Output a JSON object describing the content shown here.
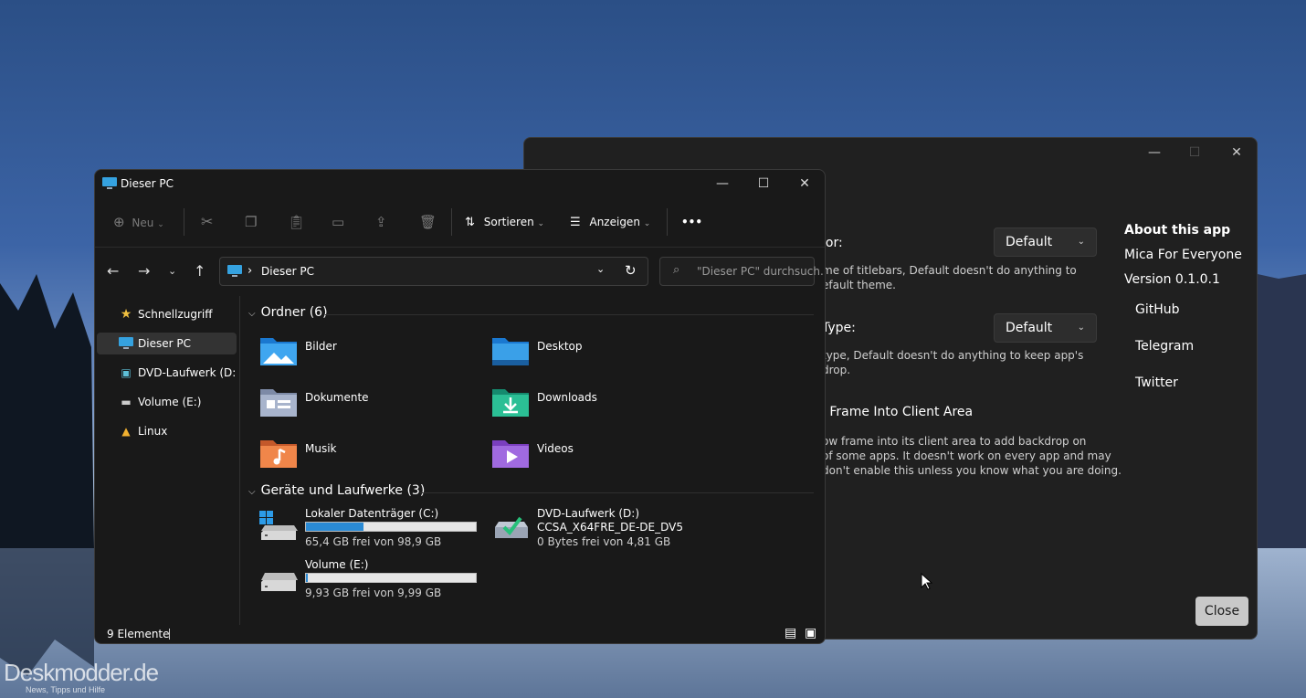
{
  "explorer": {
    "title": "Dieser PC",
    "toolbar": {
      "new_label": "Neu",
      "sort_label": "Sortieren",
      "view_label": "Anzeigen",
      "more_label": "•••"
    },
    "address": {
      "path": "Dieser PC",
      "separator": "›"
    },
    "search": {
      "placeholder": "\"Dieser PC\" durchsuch..."
    },
    "sidebar": {
      "items": [
        {
          "label": "Schnellzugriff",
          "icon": "star-icon"
        },
        {
          "label": "Dieser PC",
          "icon": "computer-icon",
          "selected": true
        },
        {
          "label": "DVD-Laufwerk (D:) C",
          "icon": "dvd-icon"
        },
        {
          "label": "Volume (E:)",
          "icon": "drive-icon"
        },
        {
          "label": "Linux",
          "icon": "linux-penguin-icon"
        }
      ]
    },
    "groups": {
      "folders": "Ordner (6)",
      "drives": "Geräte und Laufwerke (3)"
    },
    "folders": [
      {
        "name": "Bilder",
        "icon": "pictures-folder-icon"
      },
      {
        "name": "Desktop",
        "icon": "desktop-folder-icon"
      },
      {
        "name": "Dokumente",
        "icon": "documents-folder-icon"
      },
      {
        "name": "Downloads",
        "icon": "downloads-folder-icon"
      },
      {
        "name": "Musik",
        "icon": "music-folder-icon"
      },
      {
        "name": "Videos",
        "icon": "videos-folder-icon"
      }
    ],
    "drives": [
      {
        "name": "Lokaler Datenträger (C:)",
        "free": "65,4 GB frei von 98,9 GB",
        "used_fraction": 0.34
      },
      {
        "name": "DVD-Laufwerk (D:)",
        "sub": "CCSA_X64FRE_DE-DE_DV5",
        "free": "0 Bytes frei von 4,81 GB"
      },
      {
        "name": "Volume (E:)",
        "free": "9,93 GB frei von 9,99 GB",
        "used_fraction": 0.01
      }
    ],
    "status": {
      "count": "9 Elemente"
    }
  },
  "mica": {
    "color_label": "lor:",
    "color_desc": [
      "me of titlebars, Default doesn't do anything to",
      "efault theme."
    ],
    "color_value": "Default",
    "type_label": "Type:",
    "type_desc": [
      "type, Default doesn't do anything to keep app's",
      "drop."
    ],
    "type_value": "Default",
    "frame_label": "l Frame Into Client Area",
    "frame_desc": [
      "ow frame into its client area to add backdrop on",
      "of some apps. It doesn't work on every app and may",
      "don't enable this unless you know what you are doing."
    ],
    "about_title": "About this app",
    "app_name": "Mica For Everyone",
    "version": "Version 0.1.0.1",
    "links": [
      "GitHub",
      "Telegram",
      "Twitter"
    ],
    "close_label": "Close"
  },
  "watermark": {
    "site": "Deskmodder.de",
    "tagline": "News, Tipps und Hilfe"
  },
  "colors": {
    "accent": "#2a8ad4",
    "window_bg": "#191919",
    "dialog_bg": "#202020"
  }
}
